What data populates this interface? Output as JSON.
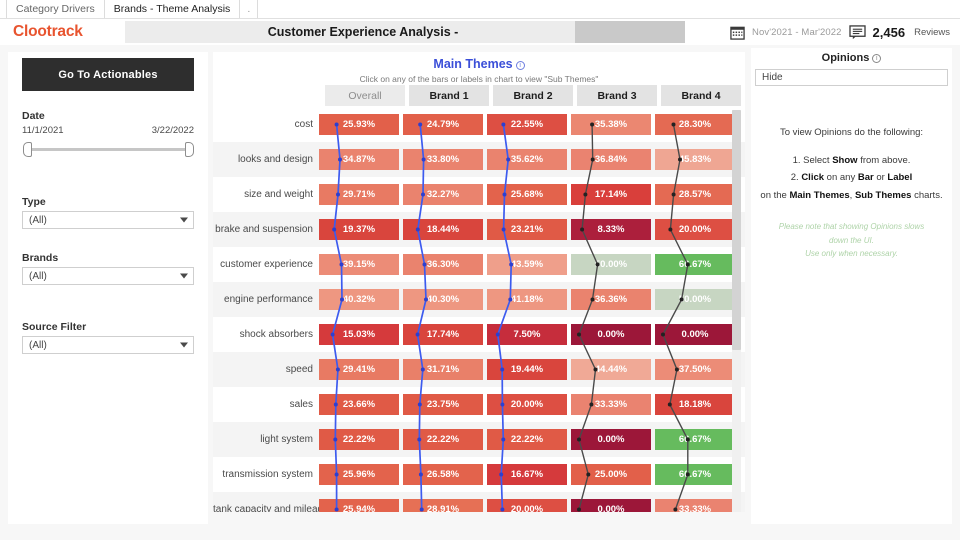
{
  "workbook_tabs": [
    {
      "label": "Category Drivers",
      "active": false
    },
    {
      "label": "Brands - Theme Analysis",
      "active": true
    },
    {
      "label": ".",
      "active": false
    }
  ],
  "header": {
    "logo": "Clootrack",
    "title": "Customer Experience Analysis -",
    "date_range": "Nov'2021 - Mar'2022",
    "review_count": "2,456",
    "review_label": "Reviews",
    "calendar_icon": "calendar-icon",
    "comment_icon": "comment-bubble-icon"
  },
  "sidebar": {
    "actionables_button": "Go To Actionables",
    "date": {
      "label": "Date",
      "start": "11/1/2021",
      "end": "3/22/2022"
    },
    "type": {
      "label": "Type",
      "value": "(All)"
    },
    "brands": {
      "label": "Brands",
      "value": "(All)"
    },
    "source_filter": {
      "label": "Source Filter",
      "value": "(All)"
    }
  },
  "chart_panel": {
    "title": "Main Themes",
    "subtitle": "Click on any of the bars or labels in chart to view \"Sub Themes\"",
    "info_icon": "info-icon"
  },
  "opinions": {
    "title": "Opinions",
    "info_icon": "info-icon",
    "select_value": "Hide",
    "intro": "To view Opinions do the following:",
    "step1_pre": "1. Select ",
    "step1_bold": "Show",
    "step1_post": " from above.",
    "step2_pre": "2. ",
    "step2_bold1": "Click",
    "step2_mid1": " on any ",
    "step2_bold2": "Bar",
    "step2_mid2": " or ",
    "step2_bold3": "Label",
    "step3_pre": "on the ",
    "step3_bold1": "Main Themes",
    "step3_mid": ", ",
    "step3_bold2": "Sub Themes",
    "step3_post": " charts.",
    "note_line1": "Please note that showing Opinions slows",
    "note_line2": "down the UI.",
    "note_line3": "Use only when necessary."
  },
  "chart_data": {
    "type": "heatmap",
    "title": "Main Themes",
    "subtitle": "Click on any of the bars or labels in chart to view \"Sub Themes\"",
    "xlabel": "",
    "ylabel": "",
    "categories": [
      "Overall",
      "Brand 1",
      "Brand 2",
      "Brand 3",
      "Brand 4"
    ],
    "rows": [
      {
        "theme": "cost",
        "values": [
          25.93,
          24.79,
          22.55,
          35.38,
          28.3
        ],
        "labels": [
          "25.93%",
          "24.79%",
          "22.55%",
          "35.38%",
          "28.30%"
        ],
        "colors": [
          "#e2604a",
          "#e2604a",
          "#dd4f43",
          "#eb8771",
          "#e46a53"
        ]
      },
      {
        "theme": "looks and design",
        "values": [
          34.87,
          33.8,
          35.62,
          36.84,
          45.83
        ],
        "labels": [
          "34.87%",
          "33.80%",
          "35.62%",
          "36.84%",
          "45.83%"
        ],
        "colors": [
          "#ea836e",
          "#ea836e",
          "#ea836e",
          "#ea8370",
          "#efa693"
        ]
      },
      {
        "theme": "size and weight",
        "values": [
          29.71,
          32.27,
          25.68,
          17.14,
          28.57
        ],
        "labels": [
          "29.71%",
          "32.27%",
          "25.68%",
          "17.14%",
          "28.57%"
        ],
        "colors": [
          "#e87a63",
          "#ea836e",
          "#e3634c",
          "#d93f3b",
          "#e46a53"
        ]
      },
      {
        "theme": "brake and suspension",
        "values": [
          19.37,
          18.44,
          23.21,
          8.33,
          20.0
        ],
        "labels": [
          "19.37%",
          "18.44%",
          "23.21%",
          "8.33%",
          "20.00%"
        ],
        "colors": [
          "#d9453d",
          "#d9453d",
          "#e05a46",
          "#ac1f3c",
          "#dd4f43"
        ]
      },
      {
        "theme": "customer experience",
        "values": [
          39.15,
          36.3,
          43.59,
          50.0,
          66.67
        ],
        "labels": [
          "39.15%",
          "36.30%",
          "43.59%",
          "50.00%",
          "66.67%"
        ],
        "colors": [
          "#ec8c77",
          "#ea836e",
          "#ef9f8b",
          "#c7d6c2",
          "#66bb5e"
        ]
      },
      {
        "theme": "engine performance",
        "values": [
          40.32,
          40.3,
          41.18,
          36.36,
          50.0
        ],
        "labels": [
          "40.32%",
          "40.30%",
          "41.18%",
          "36.36%",
          "50.00%"
        ],
        "colors": [
          "#ee9781",
          "#ee9781",
          "#ee9781",
          "#ea836e",
          "#c7d6c2"
        ]
      },
      {
        "theme": "shock absorbers",
        "values": [
          15.03,
          17.74,
          7.5,
          0.0,
          0.0
        ],
        "labels": [
          "15.03%",
          "17.74%",
          "7.50%",
          "0.00%",
          "0.00%"
        ],
        "colors": [
          "#d53a3c",
          "#d9453d",
          "#c62d3c",
          "#9c1739",
          "#9c1739"
        ]
      },
      {
        "theme": "speed",
        "values": [
          29.41,
          31.71,
          19.44,
          44.44,
          37.5
        ],
        "labels": [
          "29.41%",
          "31.71%",
          "19.44%",
          "44.44%",
          "37.50%"
        ],
        "colors": [
          "#e87a63",
          "#e98069",
          "#d9453d",
          "#f0a996",
          "#ec8c77"
        ]
      },
      {
        "theme": "sales",
        "values": [
          23.66,
          23.75,
          20.0,
          33.33,
          18.18
        ],
        "labels": [
          "23.66%",
          "23.75%",
          "20.00%",
          "33.33%",
          "18.18%"
        ],
        "colors": [
          "#e05a46",
          "#e05a46",
          "#dd4f43",
          "#ea8370",
          "#d9453d"
        ]
      },
      {
        "theme": "light system",
        "values": [
          22.22,
          22.22,
          22.22,
          0.0,
          66.67
        ],
        "labels": [
          "22.22%",
          "22.22%",
          "22.22%",
          "0.00%",
          "66.67%"
        ],
        "colors": [
          "#e05a46",
          "#e05a46",
          "#e05a46",
          "#9c1739",
          "#66bb5e"
        ]
      },
      {
        "theme": "transmission system",
        "values": [
          25.96,
          26.58,
          16.67,
          25.0,
          66.67
        ],
        "labels": [
          "25.96%",
          "26.58%",
          "16.67%",
          "25.00%",
          "66.67%"
        ],
        "colors": [
          "#e3634c",
          "#e3634c",
          "#d53a3c",
          "#e2604a",
          "#66bb5e"
        ]
      },
      {
        "theme": "tank capacity and mileage",
        "values": [
          25.94,
          28.91,
          20.0,
          0.0,
          33.33
        ],
        "labels": [
          "25.94%",
          "28.91%",
          "20.00%",
          "0.00%",
          "33.33%"
        ],
        "colors": [
          "#e3634c",
          "#e67055",
          "#dd4f43",
          "#9c1739",
          "#ea8370"
        ]
      }
    ],
    "overlay_lines": {
      "series_color_blue": "#3d5bef",
      "series_color_dark": "#4a4a4a",
      "columns": [
        "Overall",
        "Brand 1",
        "Brand 2",
        "Brand 3",
        "Brand 4"
      ]
    }
  }
}
